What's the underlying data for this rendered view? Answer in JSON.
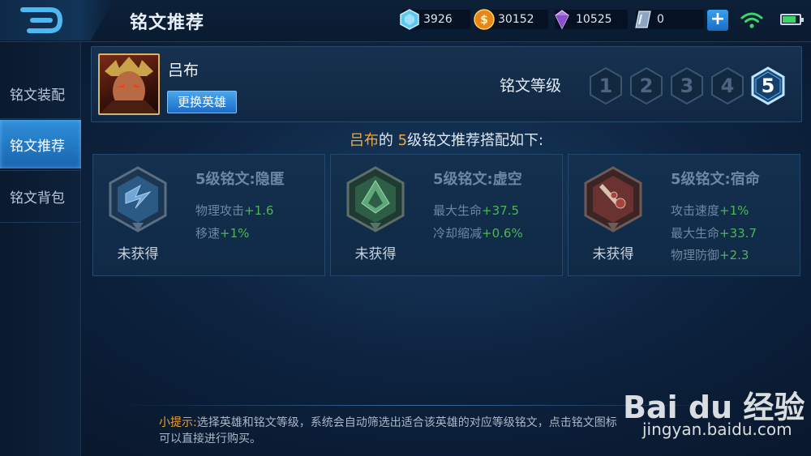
{
  "header": {
    "title": "铭文推荐",
    "back_icon": "back-arrow-icon"
  },
  "currencies": [
    {
      "name": "diamond",
      "icon": "blue-crystal-icon",
      "value": "3926",
      "color": "#5ec8ef"
    },
    {
      "name": "gold",
      "icon": "gold-coin-icon",
      "value": "30152",
      "color": "#f0a020"
    },
    {
      "name": "gem",
      "icon": "purple-gem-icon",
      "value": "10525",
      "color": "#c78cf0"
    },
    {
      "name": "coupon",
      "icon": "silver-crystal-icon",
      "value": "0",
      "color": "#9fb4cc"
    }
  ],
  "sidebar": {
    "items": [
      {
        "label": "铭文装配",
        "active": false
      },
      {
        "label": "铭文推荐",
        "active": true
      },
      {
        "label": "铭文背包",
        "active": false
      }
    ]
  },
  "hero": {
    "name": "吕布",
    "change_button": "更换英雄"
  },
  "level": {
    "label": "铭文等级",
    "options": [
      "1",
      "2",
      "3",
      "4",
      "5"
    ],
    "selected": "5"
  },
  "subtitle": {
    "hero": "吕布",
    "mid": "的 ",
    "level": "5",
    "rest": "级铭文推荐搭配如下:"
  },
  "runes": [
    {
      "name": "5级铭文:隐匿",
      "status": "未获得",
      "color": "blue",
      "attrs": [
        {
          "label": "物理攻击",
          "value": "+1.6"
        },
        {
          "label": "移速",
          "value": "+1%"
        }
      ]
    },
    {
      "name": "5级铭文:虚空",
      "status": "未获得",
      "color": "green",
      "attrs": [
        {
          "label": "最大生命",
          "value": "+37.5"
        },
        {
          "label": "冷却缩减",
          "value": "+0.6%"
        }
      ]
    },
    {
      "name": "5级铭文:宿命",
      "status": "未获得",
      "color": "red",
      "attrs": [
        {
          "label": "攻击速度",
          "value": "+1%"
        },
        {
          "label": "最大生命",
          "value": "+33.7"
        },
        {
          "label": "物理防御",
          "value": "+2.3"
        }
      ]
    }
  ],
  "hint": {
    "label": "小提示:",
    "text_line1": "选择英雄和铭文等级，系统会自动筛选出适合该英雄的对应等级铭文，点击铭文图标",
    "text_line2": "可以直接进行购买。"
  },
  "watermark": {
    "logo": "Bai du 经验",
    "url": "jingyan.baidu.com"
  }
}
